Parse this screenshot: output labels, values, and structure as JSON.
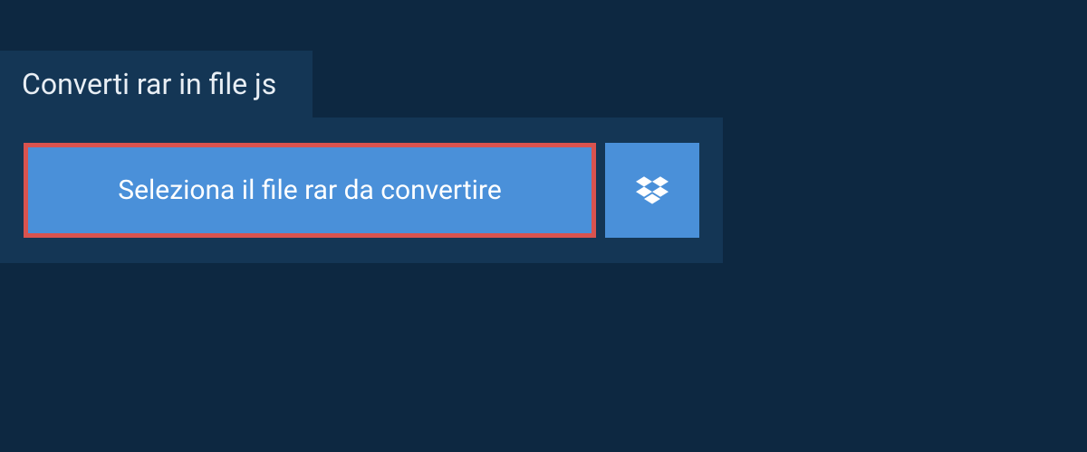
{
  "tab": {
    "title": "Converti rar in file js"
  },
  "actions": {
    "select_file_label": "Seleziona il file rar da convertire"
  }
}
